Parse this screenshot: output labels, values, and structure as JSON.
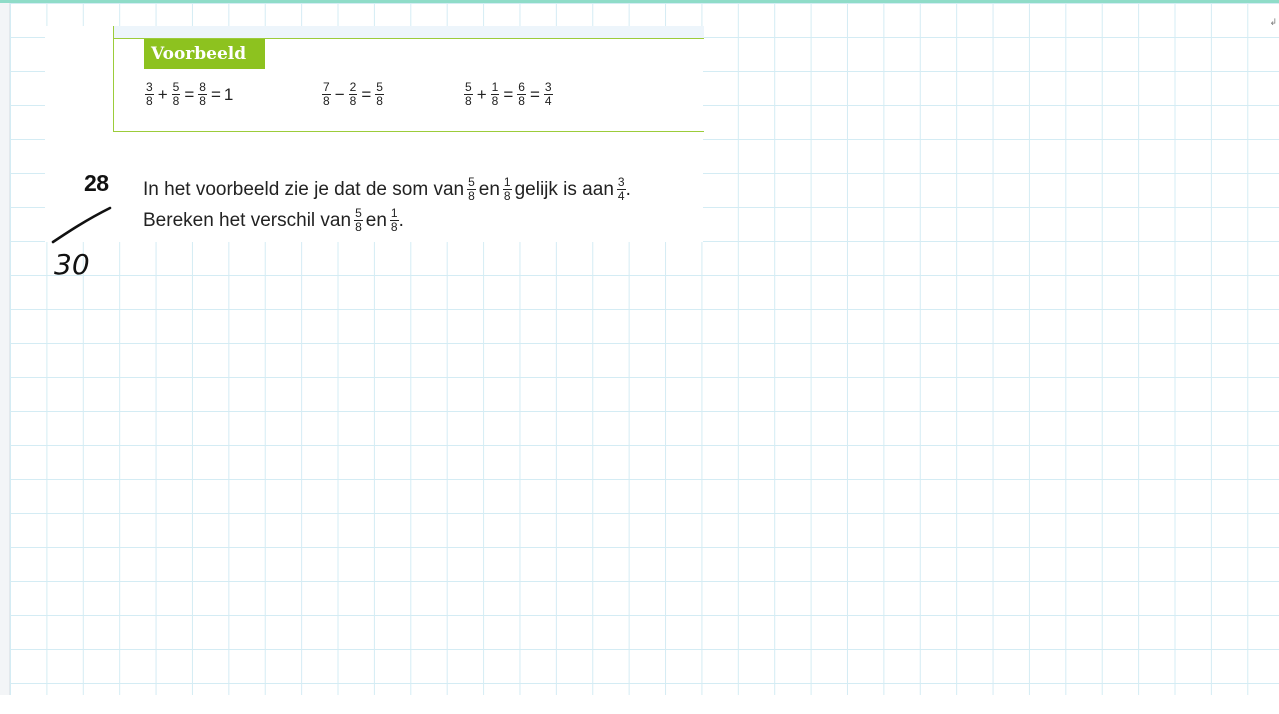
{
  "example": {
    "tag": "Voorbeeld",
    "eq1": {
      "a": [
        "3",
        "8"
      ],
      "op1": "+",
      "b": [
        "5",
        "8"
      ],
      "eq": "=",
      "c": [
        "8",
        "8"
      ],
      "eq2": "=",
      "result": "1"
    },
    "eq2": {
      "a": [
        "7",
        "8"
      ],
      "op1": "−",
      "b": [
        "2",
        "8"
      ],
      "eq": "=",
      "c": [
        "5",
        "8"
      ]
    },
    "eq3": {
      "a": [
        "5",
        "8"
      ],
      "op1": "+",
      "b": [
        "1",
        "8"
      ],
      "eq": "=",
      "c": [
        "6",
        "8"
      ],
      "eq2": "=",
      "d": [
        "3",
        "4"
      ]
    }
  },
  "exercise": {
    "number": "28",
    "line1": {
      "t1": "In het voorbeeld zie je dat de som van",
      "f1": [
        "5",
        "8"
      ],
      "t2": "en",
      "f2": [
        "1",
        "8"
      ],
      "t3": "gelijk is aan",
      "f3": [
        "3",
        "4"
      ],
      "t4": "."
    },
    "line2": {
      "t1": "Bereken het verschil van",
      "f1": [
        "5",
        "8"
      ],
      "t2": "en",
      "f2": [
        "1",
        "8"
      ],
      "t3": "."
    }
  },
  "annotation": {
    "handwritten": "30"
  },
  "colors": {
    "green": "#8dc21f",
    "grid": "#d4ecf4",
    "accent": "#8fdcc8"
  }
}
